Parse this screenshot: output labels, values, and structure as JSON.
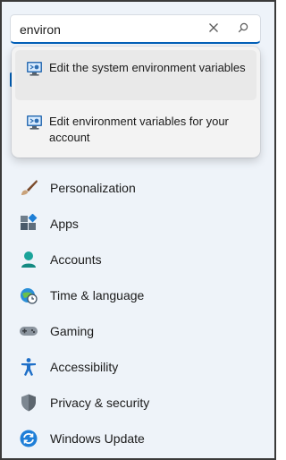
{
  "search": {
    "value": "environ"
  },
  "suggestions": [
    {
      "label": "Edit the system environment variables",
      "icon": "monitor-settings-icon"
    },
    {
      "label": "Edit environment variables for your account",
      "icon": "monitor-settings-icon"
    }
  ],
  "nav": [
    {
      "label": "Personalization",
      "icon": "paintbrush-icon"
    },
    {
      "label": "Apps",
      "icon": "apps-icon"
    },
    {
      "label": "Accounts",
      "icon": "person-icon"
    },
    {
      "label": "Time & language",
      "icon": "globe-clock-icon"
    },
    {
      "label": "Gaming",
      "icon": "gamepad-icon"
    },
    {
      "label": "Accessibility",
      "icon": "accessibility-icon"
    },
    {
      "label": "Privacy & security",
      "icon": "shield-icon"
    },
    {
      "label": "Windows Update",
      "icon": "refresh-icon"
    }
  ],
  "colors": {
    "accent": "#005fb8",
    "background": "#eef3f9"
  }
}
